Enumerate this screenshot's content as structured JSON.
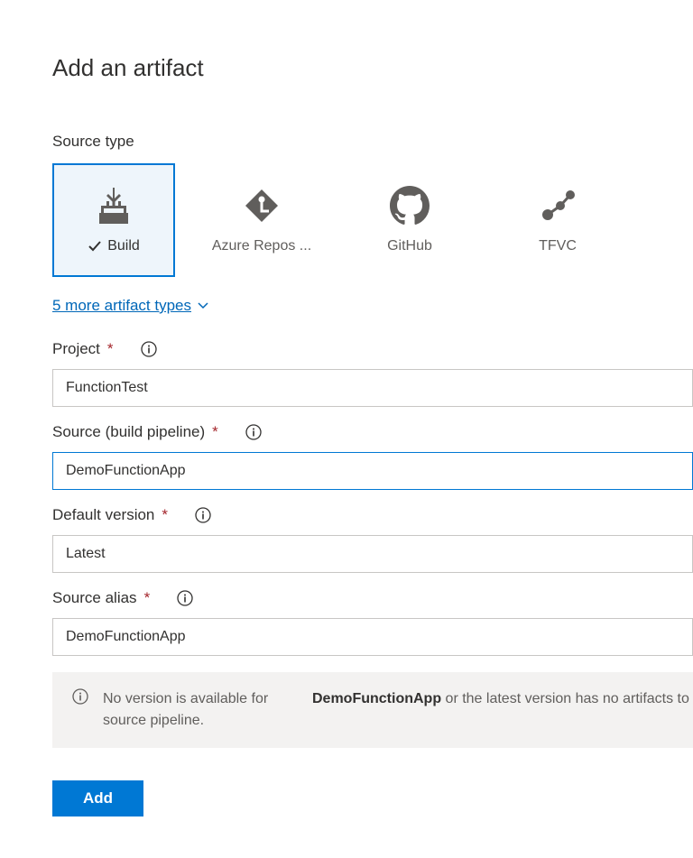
{
  "title": "Add an artifact",
  "sourceType": {
    "label": "Source type",
    "options": [
      {
        "label": "Build",
        "selected": true
      },
      {
        "label": "Azure Repos ...",
        "selected": false
      },
      {
        "label": "GitHub",
        "selected": false
      },
      {
        "label": "TFVC",
        "selected": false
      }
    ],
    "moreLink": "5 more artifact types"
  },
  "fields": {
    "project": {
      "label": "Project",
      "value": "FunctionTest"
    },
    "source": {
      "label": "Source (build pipeline)",
      "value": "DemoFunctionApp"
    },
    "defaultVersion": {
      "label": "Default version",
      "value": "Latest"
    },
    "sourceAlias": {
      "label": "Source alias",
      "value": "DemoFunctionApp"
    }
  },
  "banner": {
    "col1": "No version is available for source pipeline.",
    "boldName": "DemoFunctionApp",
    "col2rest": " or the latest version has no artifacts to"
  },
  "addButton": "Add",
  "requiredMark": "*"
}
